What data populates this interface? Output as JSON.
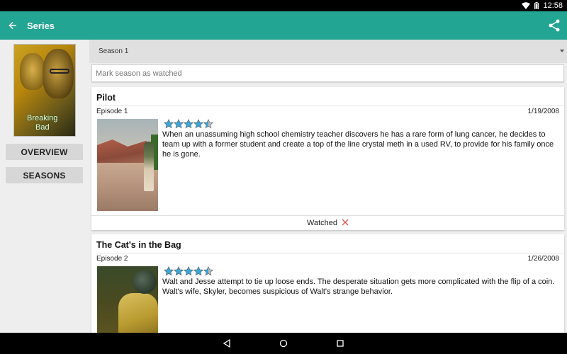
{
  "status_bar": {
    "time": "12:58"
  },
  "app_bar": {
    "title": "Series"
  },
  "sidebar": {
    "poster_title_line1": "Breaking",
    "poster_title_line2": "Bad",
    "overview_label": "OVERVIEW",
    "seasons_label": "SEASONS"
  },
  "season_selector": {
    "value": "Season 1"
  },
  "mark_watched": {
    "label": "Mark season as watched"
  },
  "episodes": [
    {
      "title": "Pilot",
      "episode": "Episode 1",
      "date": "1/19/2008",
      "rating": 4.5,
      "description": "When an unassuming high school chemistry teacher discovers he has a rare form of lung cancer, he decides to team up with a former student and create a top of the line crystal meth in a used RV, to provide for his family once he is gone.",
      "watched_label": "Watched"
    },
    {
      "title": "The Cat's in the Bag",
      "episode": "Episode 2",
      "date": "1/26/2008",
      "rating": 4.5,
      "description": "Walt and Jesse attempt to tie up loose ends. The desperate situation gets more complicated with the flip of a coin. Walt's wife, Skyler, becomes suspicious of Walt's strange behavior."
    }
  ],
  "colors": {
    "app_bar": "#22a592",
    "star": "#3aa7d8",
    "watched_x": "#d9534f"
  }
}
